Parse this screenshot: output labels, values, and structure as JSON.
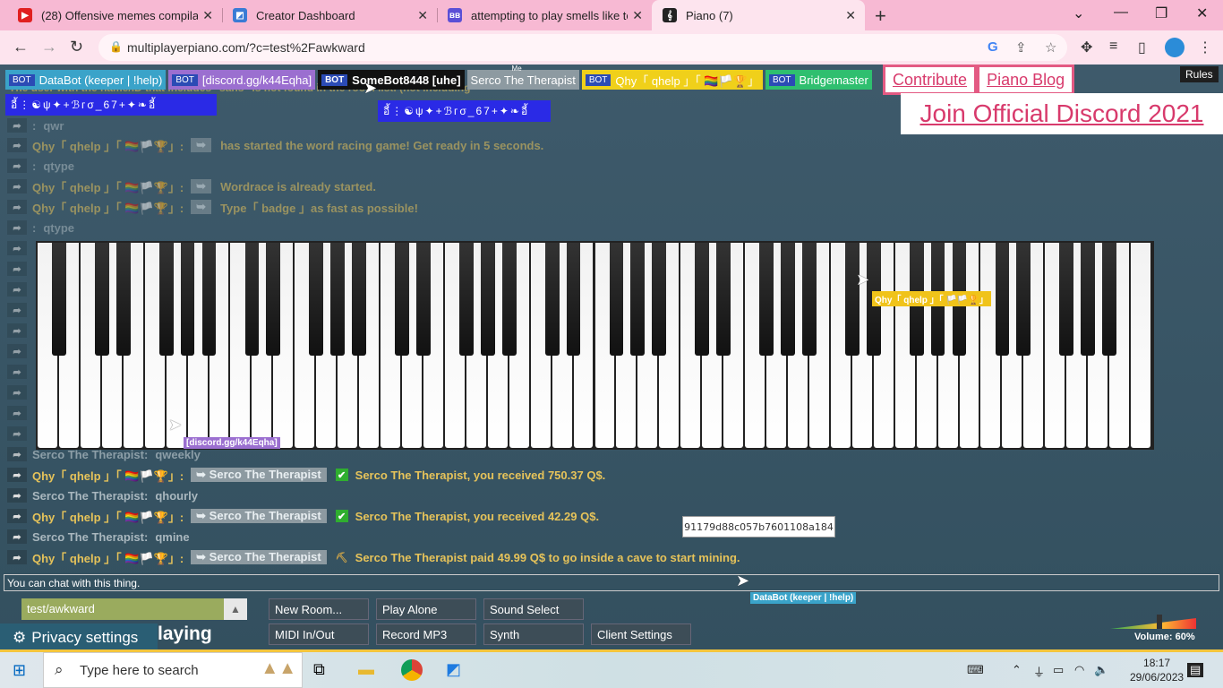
{
  "browser": {
    "tabs": [
      {
        "title": "(28) Offensive memes compilatio",
        "icon": "youtube-icon",
        "color": "#e02020"
      },
      {
        "title": "Creator Dashboard",
        "icon": "roblox-studio-icon",
        "color": "#3a7bd5"
      },
      {
        "title": "attempting to play smells like tee",
        "icon": "bb-icon",
        "color": "#5b4fd6"
      },
      {
        "title": "Piano (7)",
        "icon": "piano-icon",
        "color": "#222222"
      }
    ],
    "url": "multiplayerpiano.com/?c=test%2Fawkward"
  },
  "users": [
    {
      "bot": "BOT",
      "name": "DataBot (keeper | !help)",
      "color": "#3aa3c9"
    },
    {
      "bot": "BOT",
      "name": "[discord.gg/k44Eqha]",
      "color": "#9b6fd0"
    },
    {
      "bot": "BOT",
      "name": "SomeBot8448 [uhe]",
      "color": "#111111"
    },
    {
      "bot": "",
      "name": "Serco The Therapist",
      "color": "#8d9aa1"
    },
    {
      "bot": "BOT",
      "name": "Qhy「 qhelp 」「 🏳️‍🌈🏳️🏆」",
      "color": "#f0d01a"
    },
    {
      "bot": "BOT",
      "name": "Bridgemaster",
      "color": "#2fbf6f"
    }
  ],
  "me_label": "Me",
  "links": {
    "contribute": "Contribute",
    "blog": "Piano Blog",
    "discord": "Join Official Discord 2021",
    "rules": "Rules"
  },
  "banners": {
    "a": "อี้⋮☯ψ✦+ℬгσ_67+✦❧อี้",
    "b": "อี้⋮☯ψ✦+ℬгσ_67+✦❧อี้"
  },
  "top_faded_text": "The user with the name/ID that includes \"sans\" is not found in the room list. (not including",
  "messages": [
    {
      "name": ":",
      "text": "qwr",
      "type": "plain"
    },
    {
      "name": "Qhy「 qhelp 」「 🏳️‍🌈🏳️🏆」:",
      "tag": "➥",
      "text": "has started the word racing game! Get ready in 5 seconds.",
      "type": "bot"
    },
    {
      "name": ":",
      "text": "qtype",
      "type": "plain"
    },
    {
      "name": "Qhy「 qhelp 」「 🏳️‍🌈🏳️🏆」:",
      "tag": "➥",
      "text": "Wordrace is already started.",
      "type": "bot"
    },
    {
      "name": "Qhy「 qhelp 」「 🏳️‍🌈🏳️🏆」:",
      "tag": "➥",
      "text": "Type「 badge 」as fast as possible!",
      "type": "bot"
    },
    {
      "name": ":",
      "text": "qtype",
      "type": "plain"
    },
    {
      "name": "Serco The Therapist:",
      "text": "qweekly",
      "type": "plain"
    },
    {
      "name": "Qhy「 qhelp 」「 🏳️‍🌈🏳️🏆」:",
      "tag": "➥ Serco The Therapist",
      "check": "✔",
      "text": "Serco The Therapist, you received 750.37 Q$.",
      "type": "bot"
    },
    {
      "name": "Serco The Therapist:",
      "text": "qhourly",
      "type": "plain"
    },
    {
      "name": "Qhy「 qhelp 」「 🏳️‍🌈🏳️🏆」:",
      "tag": "➥ Serco The Therapist",
      "check": "✔",
      "text": "Serco The Therapist, you received 42.29 Q$.",
      "type": "bot"
    },
    {
      "name": "Serco The Therapist:",
      "text": "qmine",
      "type": "plain"
    },
    {
      "name": "Qhy「 qhelp 」「 🏳️‍🌈🏳️🏆」:",
      "tag": "➥ Serco The Therapist",
      "check": "⛏",
      "text": "Serco The Therapist paid 49.99 Q$ to go inside a cave to start mining.",
      "type": "bot"
    }
  ],
  "cursor_labels": {
    "qhy": "Qhy「 qhelp 」「 🏳️🏳️🏆」",
    "discord": "[discord.gg/k44Eqha]",
    "databot": "DataBot (keeper | !help)"
  },
  "tooltip": "91179d88c057b7601108a184",
  "chat_placeholder": "You can chat with this thing.",
  "room": "test/awkward",
  "buttons": {
    "new_room": "New Room...",
    "play_alone": "Play Alone",
    "sound_select": "Sound Select",
    "midi": "MIDI In/Out",
    "record": "Record MP3",
    "synth": "Synth",
    "client_settings": "Client Settings"
  },
  "privacy": "Privacy settings",
  "playing": "laying",
  "volume": "Volume: 60%",
  "taskbar": {
    "search": "Type here to search",
    "time": "18:17",
    "date": "29/06/2023"
  }
}
